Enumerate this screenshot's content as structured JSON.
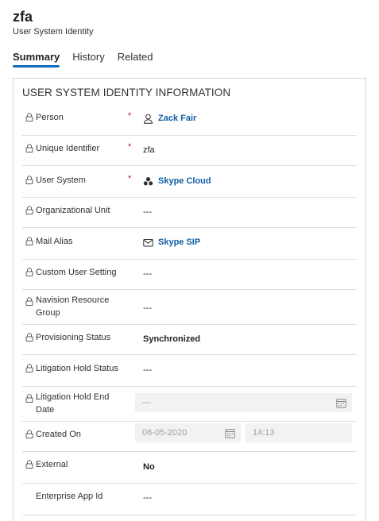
{
  "header": {
    "title": "zfa",
    "subtitle": "User System Identity"
  },
  "tabs": [
    {
      "label": "Summary",
      "active": true
    },
    {
      "label": "History",
      "active": false
    },
    {
      "label": "Related",
      "active": false
    }
  ],
  "section": {
    "title": "USER SYSTEM IDENTITY INFORMATION"
  },
  "fields": {
    "person": {
      "label": "Person",
      "required": "*",
      "value": "Zack Fair",
      "icon": "person-icon"
    },
    "unique_identifier": {
      "label": "Unique Identifier",
      "required": "*",
      "value": "zfa"
    },
    "user_system": {
      "label": "User System",
      "required": "*",
      "value": "Skype Cloud",
      "icon": "cloud-group-icon"
    },
    "organizational_unit": {
      "label": "Organizational Unit",
      "value": "---"
    },
    "mail_alias": {
      "label": "Mail Alias",
      "value": "Skype SIP",
      "icon": "mail-icon"
    },
    "custom_user_setting": {
      "label": "Custom User Setting",
      "value": "---"
    },
    "navision_resource_group": {
      "label_line1": "Navision Resource",
      "label_line2": "Group",
      "value": "---"
    },
    "provisioning_status": {
      "label": "Provisioning Status",
      "value": "Synchronized"
    },
    "litigation_hold_status": {
      "label": "Litigation Hold Status",
      "value": "---"
    },
    "litigation_hold_end_date": {
      "label_line1": "Litigation Hold End",
      "label_line2": "Date",
      "value": "---"
    },
    "created_on": {
      "label": "Created On",
      "date": "06-05-2020",
      "time": "14:13"
    },
    "external": {
      "label": "External",
      "value": "No"
    },
    "enterprise_app_id": {
      "label": "Enterprise App Id",
      "value": "---"
    }
  },
  "colors": {
    "accent": "#0f6cbd",
    "link": "#115ea3",
    "required": "#a4262c"
  }
}
